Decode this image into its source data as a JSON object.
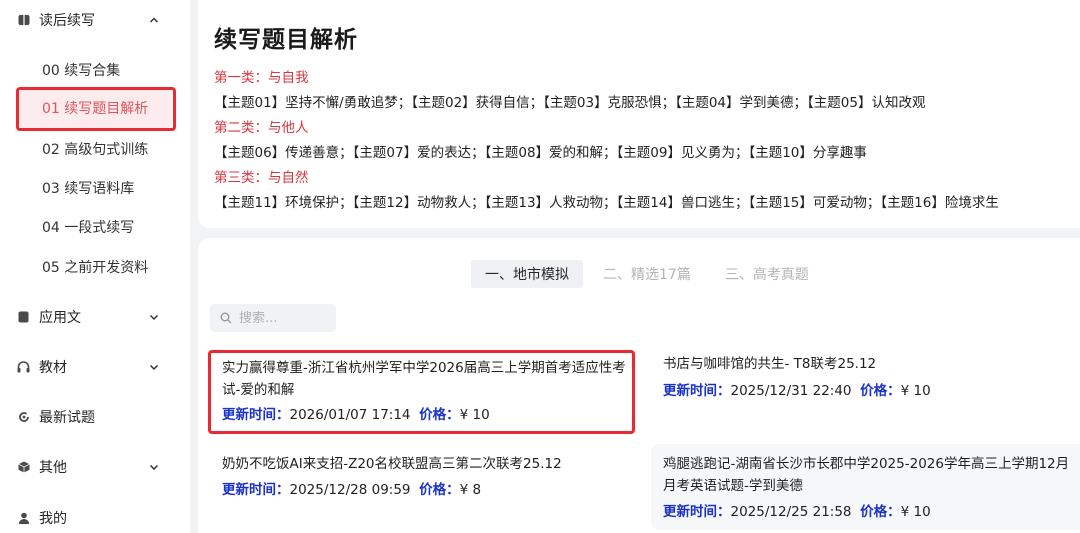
{
  "sidebar": {
    "groups": [
      {
        "label": "读后续写",
        "icon": "book-icon",
        "expanded": true
      },
      {
        "label": "应用文",
        "icon": "document-icon",
        "expanded": false
      },
      {
        "label": "教材",
        "icon": "headphones-icon",
        "expanded": false
      },
      {
        "label": "最新试题",
        "icon": "refresh-icon",
        "expanded": false
      },
      {
        "label": "其他",
        "icon": "cube-icon",
        "expanded": false
      },
      {
        "label": "我的",
        "icon": "user-icon",
        "expanded": false
      }
    ],
    "sub_items": [
      "00 续写合集",
      "01 续写题目解析",
      "02 高级句式训练",
      "03 续写语料库",
      "04 一段式续写",
      "05 之前开发资料"
    ],
    "active_sub": "01 续写题目解析"
  },
  "header": {
    "title": "续写题目解析",
    "categories": [
      {
        "title": "第一类：与自我",
        "topics": "【主题01】坚持不懈/勇敢追梦；【主题02】获得自信；【主题03】克服恐惧；【主题04】学到美德；【主题05】认知改观"
      },
      {
        "title": "第二类：与他人",
        "topics": "【主题06】传递善意；【主题07】爱的表达；【主题08】爱的和解；【主题09】见义勇为；【主题10】分享趣事"
      },
      {
        "title": "第三类：与自然",
        "topics": "【主题11】环境保护；【主题12】动物救人；【主题13】人救动物；【主题14】兽口逃生；【主题15】可爱动物；【主题16】险境求生"
      }
    ]
  },
  "tabs": [
    "一、地市模拟",
    "二、精选17篇",
    "三、高考真题"
  ],
  "active_tab": "一、地市模拟",
  "search": {
    "placeholder": "搜索..."
  },
  "labels": {
    "update": "更新时间：",
    "price": "价格："
  },
  "items": [
    {
      "title": "实力赢得尊重-浙江省杭州学军中学2026届高三上学期首考适应性考试-爱的和解",
      "time": "2026/01/07 17:14",
      "price": "¥ 10"
    },
    {
      "title": "书店与咖啡馆的共生- T8联考25.12",
      "time": "2025/12/31 22:40",
      "price": "¥ 10"
    },
    {
      "title": "奶奶不吃饭AI来支招-Z20名校联盟高三第二次联考25.12",
      "time": "2025/12/28 09:59",
      "price": "¥ 8"
    },
    {
      "title": "鸡腿逃跑记-湖南省长沙市长郡中学2025-2026学年高三上学期12月月考英语试题-学到美德",
      "time": "2025/12/25 21:58",
      "price": "¥ 10"
    }
  ],
  "colors": {
    "accent_red": "#d9363e",
    "highlight_box": "#ea2a33",
    "meta_label": "#1b32c9"
  }
}
